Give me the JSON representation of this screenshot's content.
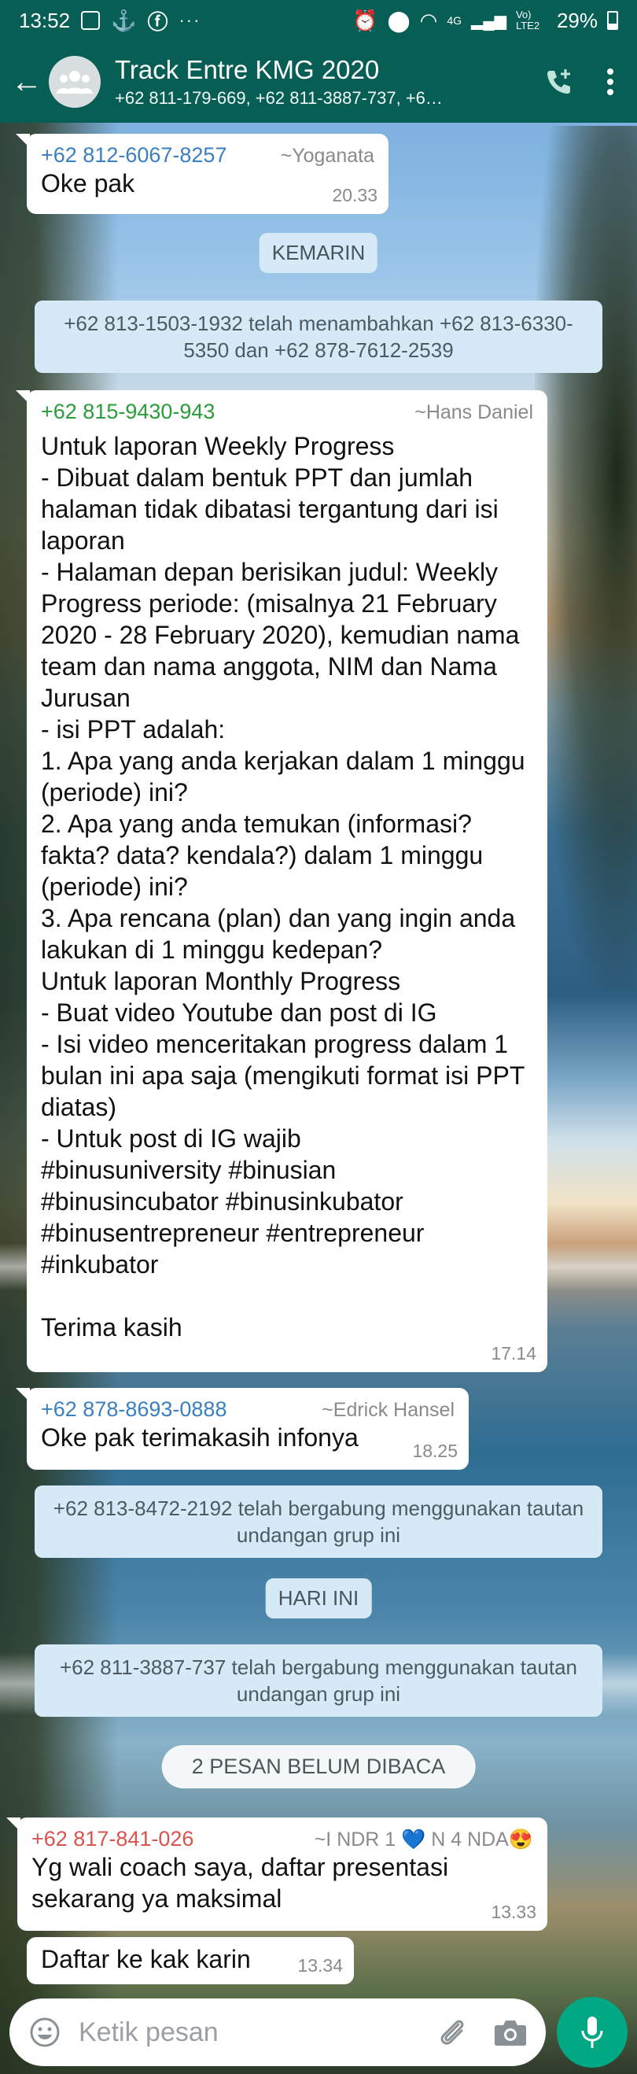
{
  "status_bar": {
    "time": "13:52",
    "dots": "···",
    "network": "4G",
    "volte": "Vo) LTE2",
    "battery": "29%"
  },
  "header": {
    "title": "Track Entre KMG 2020",
    "subtitle": "+62 811-179-669, +62 811-3887-737, +6…",
    "accent": "#075e54"
  },
  "messages": [
    {
      "phone": "+62 812-6067-8257",
      "alias": "~Yoganata",
      "text": "Oke pak",
      "time": "20.33",
      "phone_color": "#3a7fc2"
    },
    {
      "phone": "+62 815-9430-943",
      "alias": "~Hans Daniel",
      "text": "Untuk laporan Weekly Progress\n- Dibuat dalam bentuk PPT dan jumlah halaman tidak dibatasi tergantung dari isi laporan\n- Halaman depan berisikan judul: Weekly Progress periode: (misalnya 21 February 2020 - 28 February 2020), kemudian nama team dan nama anggota, NIM dan Nama Jurusan\n- isi PPT adalah:\n1. Apa yang anda kerjakan dalam 1 minggu (periode) ini?\n2. Apa yang anda temukan (informasi? fakta? data? kendala?) dalam 1 minggu (periode) ini?\n3. Apa rencana (plan) dan yang ingin anda lakukan di 1 minggu kedepan?\nUntuk laporan Monthly Progress\n- Buat video Youtube dan post di IG\n- Isi video menceritakan progress dalam 1 bulan ini apa saja (mengikuti format isi PPT diatas)\n- Untuk post di IG wajib\n#binusuniversity #binusian\n#binusincubator #binusinkubator\n#binusentrepreneur #entrepreneur\n#inkubator\n\nTerima kasih",
      "time": "17.14",
      "phone_color": "#2a9d3a"
    },
    {
      "phone": "+62 878-8693-0888",
      "alias": "~Edrick Hansel",
      "text": "Oke pak terimakasih infonya",
      "time": "18.25",
      "phone_color": "#3a7fc2"
    },
    {
      "phone": "+62 817-841-026",
      "alias": "~I NDR 1 💙 N 4 NDA😍",
      "text": "Yg wali coach saya, daftar presentasi sekarang ya maksimal",
      "time": "13.33",
      "phone_color": "#d9534f"
    },
    {
      "text": "Daftar ke kak karin",
      "time": "13.34"
    }
  ],
  "dates": {
    "yesterday": "KEMARIN",
    "today": "HARI INI"
  },
  "system": [
    "+62 813-1503-1932 telah menambahkan +62 813-6330-5350 dan +62 878-7612-2539",
    "+62 813-8472-2192 telah bergabung menggunakan tautan undangan grup ini",
    "+62 811-3887-737 telah bergabung menggunakan tautan undangan grup ini"
  ],
  "unread": "2 PESAN BELUM DIBACA",
  "composer": {
    "placeholder": "Ketik pesan"
  },
  "icons": [
    "back-arrow-icon",
    "group-avatar-icon",
    "add-call-icon",
    "more-icon",
    "emoji-icon",
    "attach-icon",
    "camera-icon",
    "mic-icon"
  ]
}
